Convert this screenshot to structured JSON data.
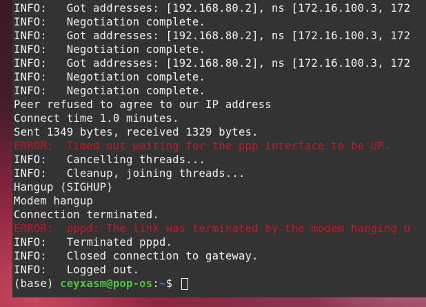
{
  "terminal": {
    "lines": [
      {
        "text": "INFO:   Got addresses: [192.168.80.2], ns [172.16.100.3, 172",
        "type": "info"
      },
      {
        "text": "INFO:   Negotiation complete.",
        "type": "info"
      },
      {
        "text": "INFO:   Got addresses: [192.168.80.2], ns [172.16.100.3, 172",
        "type": "info"
      },
      {
        "text": "INFO:   Negotiation complete.",
        "type": "info"
      },
      {
        "text": "INFO:   Got addresses: [192.168.80.2], ns [172.16.100.3, 172",
        "type": "info"
      },
      {
        "text": "INFO:   Negotiation complete.",
        "type": "info"
      },
      {
        "text": "INFO:   Negotiation complete.",
        "type": "info"
      },
      {
        "text": "Peer refused to agree to our IP address",
        "type": "info"
      },
      {
        "text": "Connect time 1.0 minutes.",
        "type": "info"
      },
      {
        "text": "Sent 1349 bytes, received 1329 bytes.",
        "type": "info"
      },
      {
        "text": "ERROR:  Timed out waiting for the ppp interface to be UP.",
        "type": "error"
      },
      {
        "text": "INFO:   Cancelling threads...",
        "type": "info"
      },
      {
        "text": "INFO:   Cleanup, joining threads...",
        "type": "info"
      },
      {
        "text": "Hangup (SIGHUP)",
        "type": "info"
      },
      {
        "text": "Modem hangup",
        "type": "info"
      },
      {
        "text": "Connection terminated.",
        "type": "info"
      },
      {
        "text": "ERROR:  pppd: The link was terminated by the modem hanging u",
        "type": "error"
      },
      {
        "text": "INFO:   Terminated pppd.",
        "type": "info"
      },
      {
        "text": "INFO:   Closed connection to gateway.",
        "type": "info"
      },
      {
        "text": "INFO:   Logged out.",
        "type": "info"
      }
    ],
    "prompt": {
      "env": "(base) ",
      "user_host": "ceyxasm@pop-os",
      "separator": ":",
      "path": "~",
      "symbol": "$ "
    },
    "colors": {
      "background": "#333333",
      "text": "#f2f2f2",
      "error": "#c01c28",
      "prompt_user": "#4ec73a",
      "prompt_path": "#3f7ee0"
    }
  }
}
